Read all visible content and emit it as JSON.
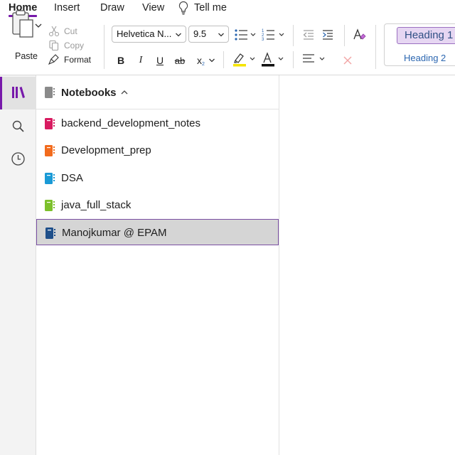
{
  "menu": {
    "tabs": [
      {
        "label": "Home",
        "active": true
      },
      {
        "label": "Insert",
        "active": false
      },
      {
        "label": "Draw",
        "active": false
      },
      {
        "label": "View",
        "active": false
      }
    ],
    "tell_me": "Tell me",
    "accent_color": "#7719aa"
  },
  "ribbon": {
    "paste_label": "Paste",
    "cut_label": "Cut",
    "copy_label": "Copy",
    "format_label": "Format",
    "font_name": "Helvetica N...",
    "font_size": "9.5",
    "formatting": {
      "bold": "B",
      "italic": "I",
      "underline": "U",
      "strikethrough": "ab",
      "subscript": "x",
      "highlight_color": "#f5e400",
      "font_color": "#111111"
    },
    "styles": {
      "heading1": "Heading 1",
      "heading2": "Heading 2"
    }
  },
  "rail": {
    "items": [
      {
        "icon": "notebooks-icon",
        "active": true
      },
      {
        "icon": "search-icon",
        "active": false
      },
      {
        "icon": "recent-clock-icon",
        "active": false
      }
    ]
  },
  "notebooks": {
    "header": "Notebooks",
    "items": [
      {
        "label": "backend_development_notes",
        "color": "#d81b60",
        "selected": false
      },
      {
        "label": "Development_prep",
        "color": "#f26b1d",
        "selected": false
      },
      {
        "label": "DSA",
        "color": "#1a9ad6",
        "selected": false
      },
      {
        "label": "java_full_stack",
        "color": "#7cc02b",
        "selected": false
      },
      {
        "label": "Manojkumar @ EPAM",
        "color": "#1f4f8a",
        "selected": true
      }
    ]
  }
}
